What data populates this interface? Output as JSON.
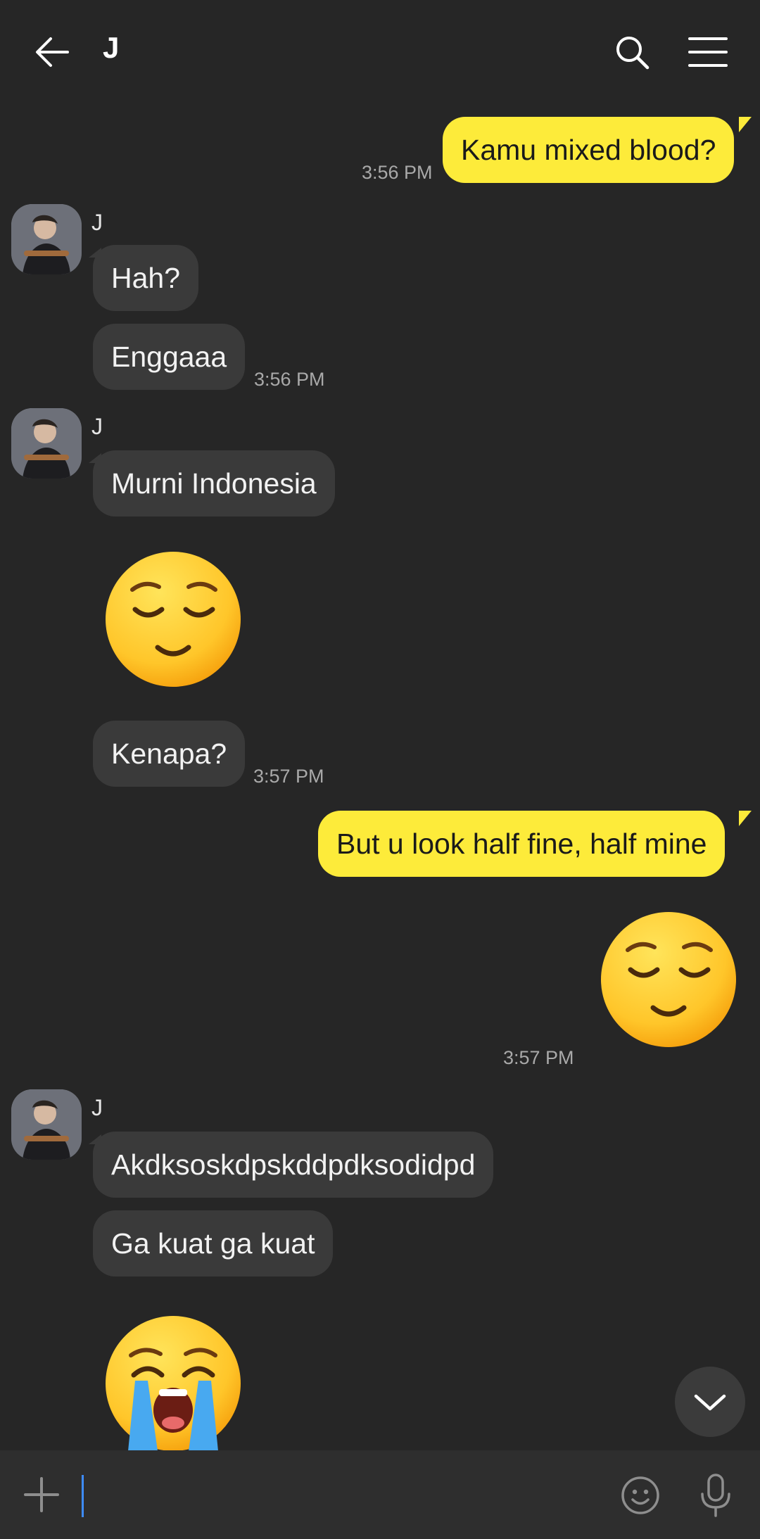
{
  "header": {
    "back_icon": "back-arrow-icon",
    "title": "J",
    "search_icon": "search-icon",
    "menu_icon": "menu-icon"
  },
  "messages": [
    {
      "from": "me",
      "text": "Kamu mixed blood?",
      "time": "3:56 PM"
    },
    {
      "from": "J",
      "sender": "J",
      "text": "Hah?"
    },
    {
      "from": "J",
      "text": "Enggaaa",
      "time": "3:56 PM"
    },
    {
      "from": "J",
      "sender": "J",
      "text": "Murni Indonesia"
    },
    {
      "from": "J",
      "emoji": "relieved-face-emoji"
    },
    {
      "from": "J",
      "text": "Kenapa?",
      "time": "3:57 PM"
    },
    {
      "from": "me",
      "text": "But u look half fine, half mine"
    },
    {
      "from": "me",
      "emoji": "relieved-face-emoji",
      "time": "3:57 PM"
    },
    {
      "from": "J",
      "sender": "J",
      "text": "Akdksoskdpskddpdksodidpd"
    },
    {
      "from": "J",
      "text": "Ga kuat ga kuat"
    },
    {
      "from": "J",
      "emoji": "loudly-crying-face-emoji"
    }
  ],
  "composer": {
    "plus_icon": "plus-icon",
    "input_value": "",
    "emoji_icon": "emoji-icon",
    "mic_icon": "microphone-icon"
  },
  "scroll_button_icon": "chevron-down-icon",
  "colors": {
    "background": "#262626",
    "incoming_bubble": "#3a3a3a",
    "outgoing_bubble": "#fdeb3a",
    "timestamp": "#a9a9a9",
    "caret": "#3e8cff"
  }
}
